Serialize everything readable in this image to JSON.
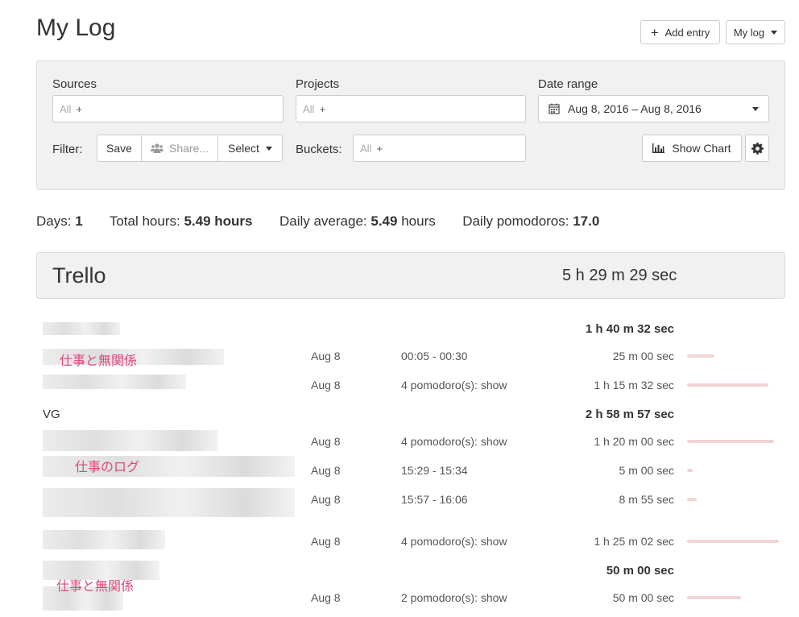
{
  "page": {
    "title": "My Log"
  },
  "header": {
    "add_entry": "Add entry",
    "mylog_dropdown": "My log"
  },
  "filters": {
    "sources_label": "Sources",
    "projects_label": "Projects",
    "date_range_label": "Date range",
    "all": "All",
    "plus": "+",
    "date_range_value": "Aug 8, 2016 – Aug 8, 2016",
    "filter_label": "Filter:",
    "save": "Save",
    "share": "Share...",
    "select": "Select",
    "buckets_label": "Buckets:",
    "show_chart": "Show Chart"
  },
  "stats": {
    "days_label": "Days:",
    "days": "1",
    "total_label": "Total hours:",
    "total": "5.49 hours",
    "avg_label": "Daily average:",
    "avg_val": "5.49",
    "avg_unit": "hours",
    "pom_label": "Daily pomodoros:",
    "pom": "17.0"
  },
  "group": {
    "name": "Trello",
    "total": "5 h 29 m 29 sec"
  },
  "subtotals": [
    "1 h 40 m 32 sec",
    "2 h 58 m 57 sec",
    "50 m 00 sec"
  ],
  "labels": {
    "vg": "VG",
    "jp1": "仕事と無関係",
    "jp2": "仕事のログ",
    "jp3": "仕事と無関係"
  },
  "entries": [
    {
      "date": "Aug 8",
      "time": "00:05 - 00:30",
      "duration": "25 m 00 sec",
      "fraction": 0.2
    },
    {
      "date": "Aug 8",
      "time": "4 pomodoro(s): show",
      "duration": "1 h 15 m 32 sec",
      "fraction": 0.6
    },
    {
      "date": "Aug 8",
      "time": "4 pomodoro(s): show",
      "duration": "1 h 20 m 00 sec",
      "fraction": 0.64
    },
    {
      "date": "Aug 8",
      "time": "15:29 - 15:34",
      "duration": "5 m 00 sec",
      "fraction": 0.04
    },
    {
      "date": "Aug 8",
      "time": "15:57 - 16:06",
      "duration": "8 m 55 sec",
      "fraction": 0.07
    },
    {
      "date": "Aug 8",
      "time": "4 pomodoro(s): show",
      "duration": "1 h 25 m 02 sec",
      "fraction": 0.68
    },
    {
      "date": "Aug 8",
      "time": "2 pomodoro(s): show",
      "duration": "50 m 00 sec",
      "fraction": 0.4
    }
  ]
}
